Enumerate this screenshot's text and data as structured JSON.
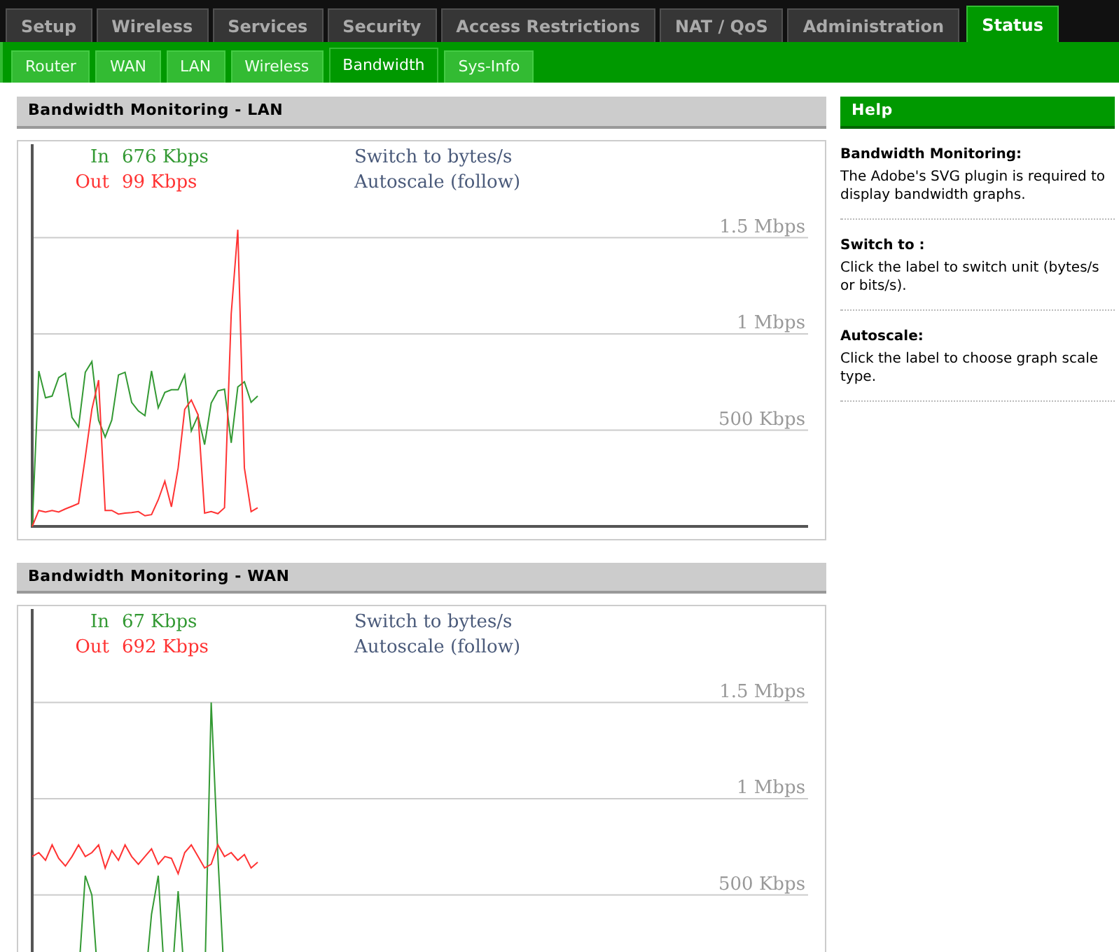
{
  "tabs": [
    {
      "label": "Setup",
      "selected": false
    },
    {
      "label": "Wireless",
      "selected": false
    },
    {
      "label": "Services",
      "selected": false
    },
    {
      "label": "Security",
      "selected": false
    },
    {
      "label": "Access Restrictions",
      "selected": false
    },
    {
      "label": "NAT / QoS",
      "selected": false
    },
    {
      "label": "Administration",
      "selected": false
    },
    {
      "label": "Status",
      "selected": true
    }
  ],
  "subtabs": [
    {
      "label": "Router",
      "selected": false
    },
    {
      "label": "WAN",
      "selected": false
    },
    {
      "label": "LAN",
      "selected": false
    },
    {
      "label": "Wireless",
      "selected": false
    },
    {
      "label": "Bandwidth",
      "selected": true
    },
    {
      "label": "Sys-Info",
      "selected": false
    }
  ],
  "graphs": [
    {
      "title": "Bandwidth Monitoring - LAN",
      "in_label": "In",
      "in_value": "676 Kbps",
      "out_label": "Out",
      "out_value": "99 Kbps",
      "switch_link": "Switch to bytes/s",
      "autoscale_link": "Autoscale (follow)",
      "scale_labels": [
        "1.5 Mbps",
        "1 Mbps",
        "500 Kbps"
      ]
    },
    {
      "title": "Bandwidth Monitoring - WAN",
      "in_label": "In",
      "in_value": "67 Kbps",
      "out_label": "Out",
      "out_value": "692 Kbps",
      "switch_link": "Switch to bytes/s",
      "autoscale_link": "Autoscale (follow)",
      "scale_labels": [
        "1.5 Mbps",
        "1 Mbps",
        "500 Kbps"
      ]
    }
  ],
  "help": {
    "title": "Help",
    "items": [
      {
        "heading": "Bandwidth Monitoring:",
        "text": "The Adobe's SVG plugin is required to display bandwidth graphs."
      },
      {
        "heading": "Switch to :",
        "text": "Click the label to switch unit (bytes/s or bits/s)."
      },
      {
        "heading": "Autoscale:",
        "text": "Click the label to choose graph scale type."
      }
    ]
  }
}
